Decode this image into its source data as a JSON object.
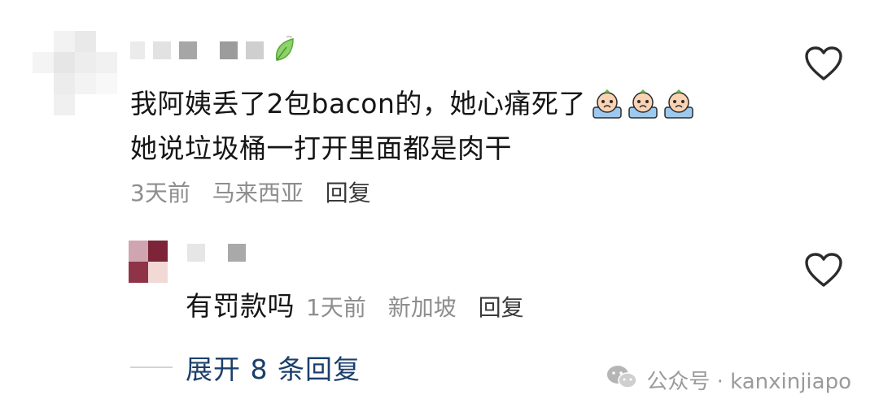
{
  "comments": [
    {
      "text_line1": "我阿姨丢了2包bacon的，她心痛死了",
      "text_line2": "她说垃圾桶一打开里面都是肉干",
      "time": "3天前",
      "location": "马来西亚",
      "reply_label": "回复",
      "badge_icon": "leaf-icon",
      "emoji_icon": "crying-face-emoji"
    },
    {
      "text": "有罚款吗",
      "time": "1天前",
      "location": "新加坡",
      "reply_label": "回复"
    }
  ],
  "expand_label": "展开 8 条回复",
  "watermark": {
    "text": "公众号 · kanxinjiapo",
    "icon": "wechat-icon"
  },
  "colors": {
    "text": "#151515",
    "meta": "#8e8e8e",
    "expand_link": "#1b3f6b",
    "heart_outline": "#2b2b2b"
  }
}
